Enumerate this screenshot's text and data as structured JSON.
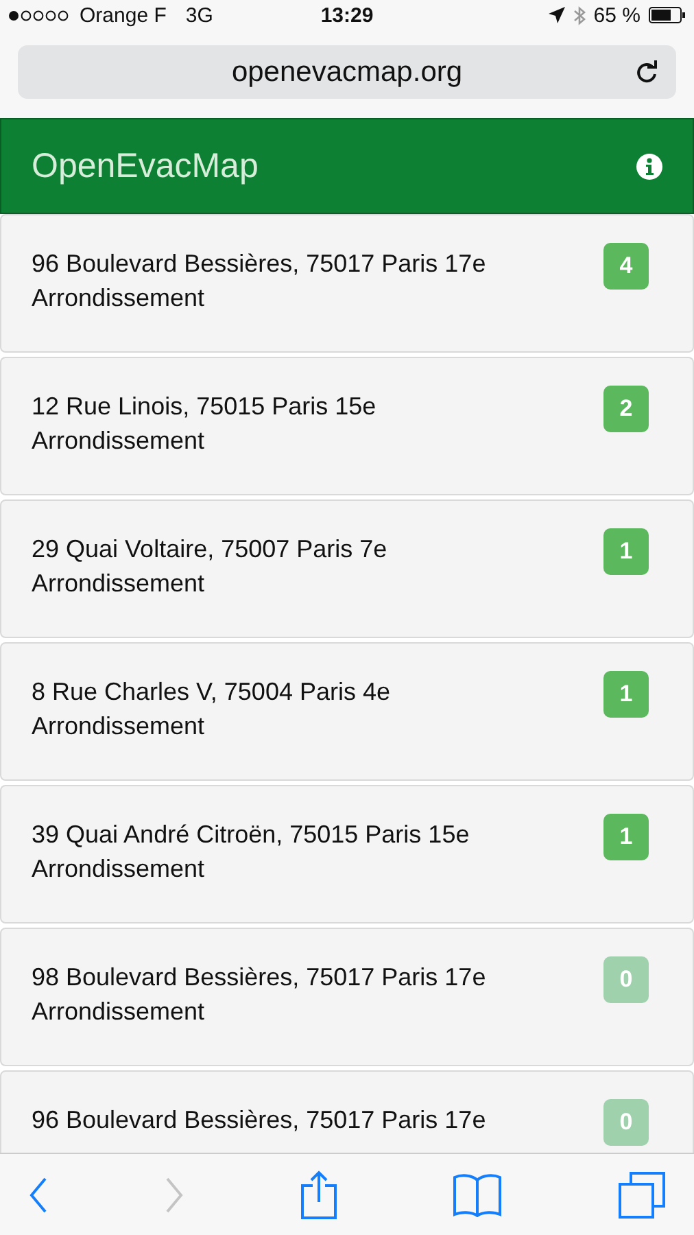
{
  "status_bar": {
    "carrier": "Orange F",
    "network": "3G",
    "time": "13:29",
    "battery": "65 %"
  },
  "url_bar": {
    "url": "openevacmap.org"
  },
  "header": {
    "title": "OpenEvacMap"
  },
  "items": [
    {
      "address": "96 Boulevard Bessières, 75017 Paris 17e Arrondissement",
      "count": "4",
      "dimmed": false
    },
    {
      "address": "12 Rue Linois, 75015 Paris 15e Arrondissement",
      "count": "2",
      "dimmed": false
    },
    {
      "address": "29 Quai Voltaire, 75007 Paris 7e Arrondissement",
      "count": "1",
      "dimmed": false
    },
    {
      "address": "8 Rue Charles V, 75004 Paris 4e Arrondissement",
      "count": "1",
      "dimmed": false
    },
    {
      "address": "39 Quai André Citroën, 75015 Paris 15e Arrondissement",
      "count": "1",
      "dimmed": false
    },
    {
      "address": "98 Boulevard Bessières, 75017 Paris 17e Arrondissement",
      "count": "0",
      "dimmed": true
    },
    {
      "address": "96 Boulevard Bessières, 75017 Paris 17e",
      "count": "0",
      "dimmed": true
    }
  ],
  "toolbar": [
    {
      "kind": "back",
      "disabled": false
    },
    {
      "kind": "forward",
      "disabled": true
    },
    {
      "kind": "share",
      "disabled": false
    },
    {
      "kind": "bookmarks",
      "disabled": false
    },
    {
      "kind": "tabs",
      "disabled": false
    }
  ]
}
